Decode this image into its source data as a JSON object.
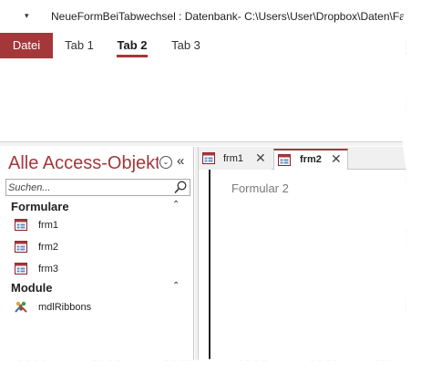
{
  "titlebar": {
    "qa_menu_glyph": "▾",
    "title": "NeueFormBeiTabwechsel : Datenbank- C:\\Users\\User\\Dropbox\\Daten\\Fa"
  },
  "ribbon": {
    "tabs": [
      {
        "label": "Datei"
      },
      {
        "label": "Tab 1"
      },
      {
        "label": "Tab 2",
        "active": true
      },
      {
        "label": "Tab 3"
      }
    ]
  },
  "nav": {
    "title": "Alle Access-Objekte",
    "menu_glyph": "⌄",
    "collapse_glyph": "«",
    "search": {
      "placeholder": "Suchen...",
      "value": ""
    },
    "groups": [
      {
        "label": "Formulare",
        "toggle": "⌃",
        "items": [
          "frm1",
          "frm2",
          "frm3"
        ],
        "icon": "form-icon"
      },
      {
        "label": "Module",
        "toggle": "⌃",
        "items": [
          "mdlRibbons"
        ],
        "icon": "module-icon"
      }
    ]
  },
  "doc_tabs": [
    {
      "label": "frm1",
      "close": "✕",
      "icon": "form-icon"
    },
    {
      "label": "frm2",
      "close": "✕",
      "icon": "form-icon",
      "active": true
    }
  ],
  "document": {
    "caption": "Formular 2"
  },
  "colors": {
    "accent": "#a4373a",
    "border": "#c8c8c8",
    "caption_gray": "#7a7a7a"
  }
}
